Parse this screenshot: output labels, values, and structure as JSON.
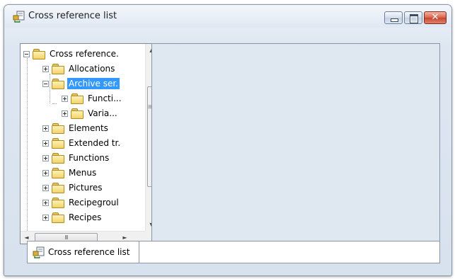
{
  "window": {
    "title": "Cross reference list",
    "icon": "cross-reference-icon"
  },
  "caption_buttons": {
    "minimize": "minimize",
    "maximize": "maximize",
    "close": "close"
  },
  "tree": {
    "root": "Cross reference.",
    "items": [
      {
        "label": "Allocations",
        "level": 1,
        "expander": "plus"
      },
      {
        "label": "Archive ser.",
        "level": 1,
        "expander": "minus",
        "selected": true
      },
      {
        "label": "Functi...",
        "level": 2,
        "expander": "plus"
      },
      {
        "label": "Varia...",
        "level": 2,
        "expander": "plus"
      },
      {
        "label": "Elements",
        "level": 1,
        "expander": "plus"
      },
      {
        "label": "Extended tr.",
        "level": 1,
        "expander": "plus"
      },
      {
        "label": "Functions",
        "level": 1,
        "expander": "plus"
      },
      {
        "label": "Menus",
        "level": 1,
        "expander": "plus"
      },
      {
        "label": "Pictures",
        "level": 1,
        "expander": "plus"
      },
      {
        "label": "Recipegroul",
        "level": 1,
        "expander": "plus"
      },
      {
        "label": "Recipes",
        "level": 1,
        "expander": "plus"
      }
    ]
  },
  "scrollbars": {
    "vertical": {
      "up": "▲",
      "down": "▼",
      "grip": "≡"
    },
    "horizontal": {
      "left": "◄",
      "right": "►",
      "grip": "III"
    }
  },
  "tabs": [
    {
      "label": "Cross reference list",
      "icon": "cross-reference-icon"
    }
  ]
}
